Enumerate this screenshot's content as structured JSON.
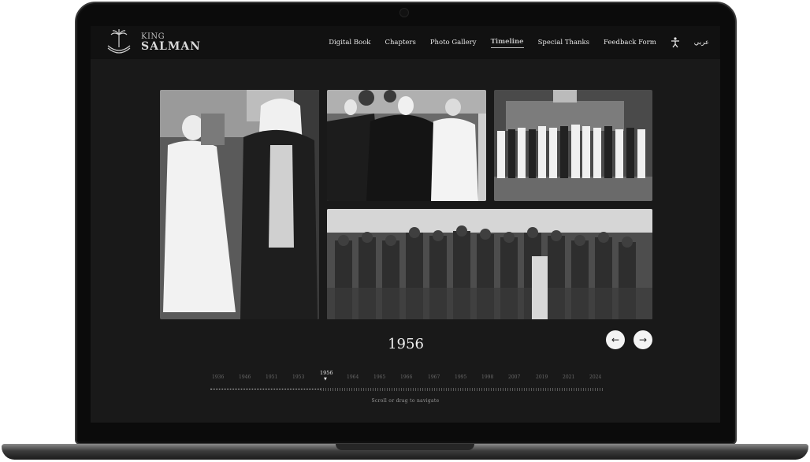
{
  "brand": {
    "line1": "KING",
    "line2": "SALMAN"
  },
  "nav": {
    "items": [
      {
        "label": "Digital Book"
      },
      {
        "label": "Chapters"
      },
      {
        "label": "Photo Gallery"
      },
      {
        "label": "Timeline",
        "active": true
      },
      {
        "label": "Special Thanks"
      },
      {
        "label": "Feedback Form"
      }
    ],
    "accessibility_icon": "accessibility-icon",
    "language": "عربي"
  },
  "gallery": {
    "year": "1956",
    "prev_icon": "←",
    "next_icon": "→"
  },
  "timeline": {
    "current": "1956",
    "years": [
      "1936",
      "1946",
      "1951",
      "1953",
      "1964",
      "1965",
      "1966",
      "1967",
      "1995",
      "1998",
      "2007",
      "2019",
      "2021",
      "2024"
    ],
    "progress": 0.28,
    "hint": "Scroll or drag to navigate"
  },
  "colors": {
    "screen_bg": "#191919",
    "header_bg": "#111111",
    "text": "#e6e6e6"
  }
}
